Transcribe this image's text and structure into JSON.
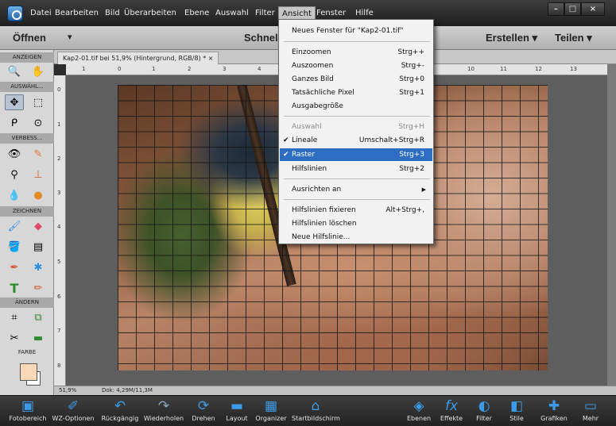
{
  "menubar": {
    "items": [
      "Datei",
      "Bearbeiten",
      "Bild",
      "Überarbeiten",
      "Ebene",
      "Auswahl",
      "Filter",
      "Ansicht",
      "Fenster",
      "Hilfe"
    ],
    "active_index": 7
  },
  "window_buttons": [
    "–",
    "□",
    "×"
  ],
  "modebar": {
    "open_label": "Öffnen",
    "open_caret": "▾",
    "mode_label": "Schnell",
    "create_label": "Erstellen ▾",
    "share_label": "Teilen ▾"
  },
  "toolbox": {
    "sections": [
      "ANZEIGEN",
      "AUSWÄHL...",
      "VERBESS...",
      "ZEICHNEN",
      "ÄNDERN",
      "FARBE"
    ]
  },
  "document_tab": "Kap2-01.tif bei 51,9% (Hintergrund, RGB/8) * ×",
  "ruler_h_labels": [
    "1",
    "0",
    "1",
    "2",
    "3",
    "4",
    "10",
    "11",
    "12",
    "13"
  ],
  "ruler_v_labels": [
    "0",
    "1",
    "2",
    "3",
    "4",
    "5",
    "6",
    "7",
    "8"
  ],
  "status": {
    "zoom": "51,9%",
    "doc_size": "Dok: 4,29M/11,3M"
  },
  "view_menu": {
    "items": [
      {
        "label": "Neues Fenster für \"Kap2-01.tif\"",
        "shortcut": ""
      },
      {
        "label": "Einzoomen",
        "shortcut": "Strg++"
      },
      {
        "label": "Auszoomen",
        "shortcut": "Strg+-"
      },
      {
        "label": "Ganzes Bild",
        "shortcut": "Strg+0"
      },
      {
        "label": "Tatsächliche Pixel",
        "shortcut": "Strg+1"
      },
      {
        "label": "Ausgabegröße",
        "shortcut": ""
      },
      {
        "label": "Auswahl",
        "shortcut": "Strg+H"
      },
      {
        "label": "Lineale",
        "shortcut": "Umschalt+Strg+R"
      },
      {
        "label": "Raster",
        "shortcut": "Strg+3"
      },
      {
        "label": "Hilfslinien",
        "shortcut": "Strg+2"
      },
      {
        "label": "Ausrichten an",
        "shortcut": ""
      },
      {
        "label": "Hilfslinien fixieren",
        "shortcut": "Alt+Strg+,"
      },
      {
        "label": "Hilfslinien löschen",
        "shortcut": ""
      },
      {
        "label": "Neue Hilfslinie...",
        "shortcut": ""
      }
    ],
    "checkmark": "✔",
    "submenu_arrow": "▶"
  },
  "bottom_bar": {
    "items": [
      {
        "label": "Fotobereich",
        "icon": "photo-bin-icon"
      },
      {
        "label": "WZ-Optionen",
        "icon": "tool-options-icon"
      },
      {
        "label": "Rückgängig",
        "icon": "undo-icon"
      },
      {
        "label": "Wiederholen",
        "icon": "redo-icon"
      },
      {
        "label": "Drehen",
        "icon": "rotate-icon"
      },
      {
        "label": "Layout",
        "icon": "layout-icon"
      },
      {
        "label": "Organizer",
        "icon": "organizer-icon"
      },
      {
        "label": "Startbildschirm",
        "icon": "home-icon"
      },
      {
        "label": "Ebenen",
        "icon": "layers-icon"
      },
      {
        "label": "Effekte",
        "icon": "effects-icon"
      },
      {
        "label": "Filter",
        "icon": "filter-icon"
      },
      {
        "label": "Stile",
        "icon": "styles-icon"
      },
      {
        "label": "Grafiken",
        "icon": "graphics-icon"
      },
      {
        "label": "Mehr",
        "icon": "more-icon"
      }
    ]
  }
}
